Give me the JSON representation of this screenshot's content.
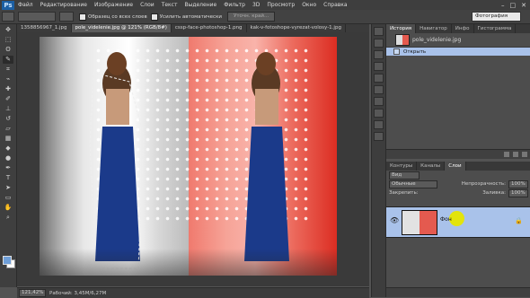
{
  "menu": {
    "logo": "Ps",
    "items": [
      "Файл",
      "Редактирование",
      "Изображение",
      "Слои",
      "Текст",
      "Выделение",
      "Фильтр",
      "3D",
      "Просмотр",
      "Окно",
      "Справка"
    ],
    "controls": [
      "–",
      "□",
      "✕"
    ]
  },
  "options": {
    "sample_all_layers": "Образец со всех слоев",
    "auto_enhance": "Усилить автоматически",
    "refine_edge": "Уточн. край...",
    "workspace": "Фотография"
  },
  "tabs": [
    "1358856967_1.jpg",
    "pole_videlenie.jpg @ 121% (RGB/8#)",
    "cssp-face-photoshop-1.png",
    "kak-v-fotoshope-vyrezat-volosy-1.jpg"
  ],
  "status": {
    "zoom": "121,42%",
    "doc": "Рабочий: 3,45M/6,27M"
  },
  "history": {
    "tabs": [
      "История",
      "Навигатор",
      "Инфо",
      "Гистограмма"
    ],
    "snapshot": "pole_videlenie.jpg",
    "state": "Открыть"
  },
  "layers": {
    "tabs": [
      "Контуры",
      "Каналы",
      "Слои"
    ],
    "kind": "Вид",
    "mode": "Обычные",
    "opacity_label": "Непрозрачность:",
    "opacity": "100%",
    "lock_label": "Закрепить:",
    "fill_label": "Заливка:",
    "fill": "100%",
    "layer_name": "Фон"
  },
  "colors": {
    "accent": "#a9c2ea",
    "foreground": "#6f9fd8",
    "background": "#ffffff"
  }
}
